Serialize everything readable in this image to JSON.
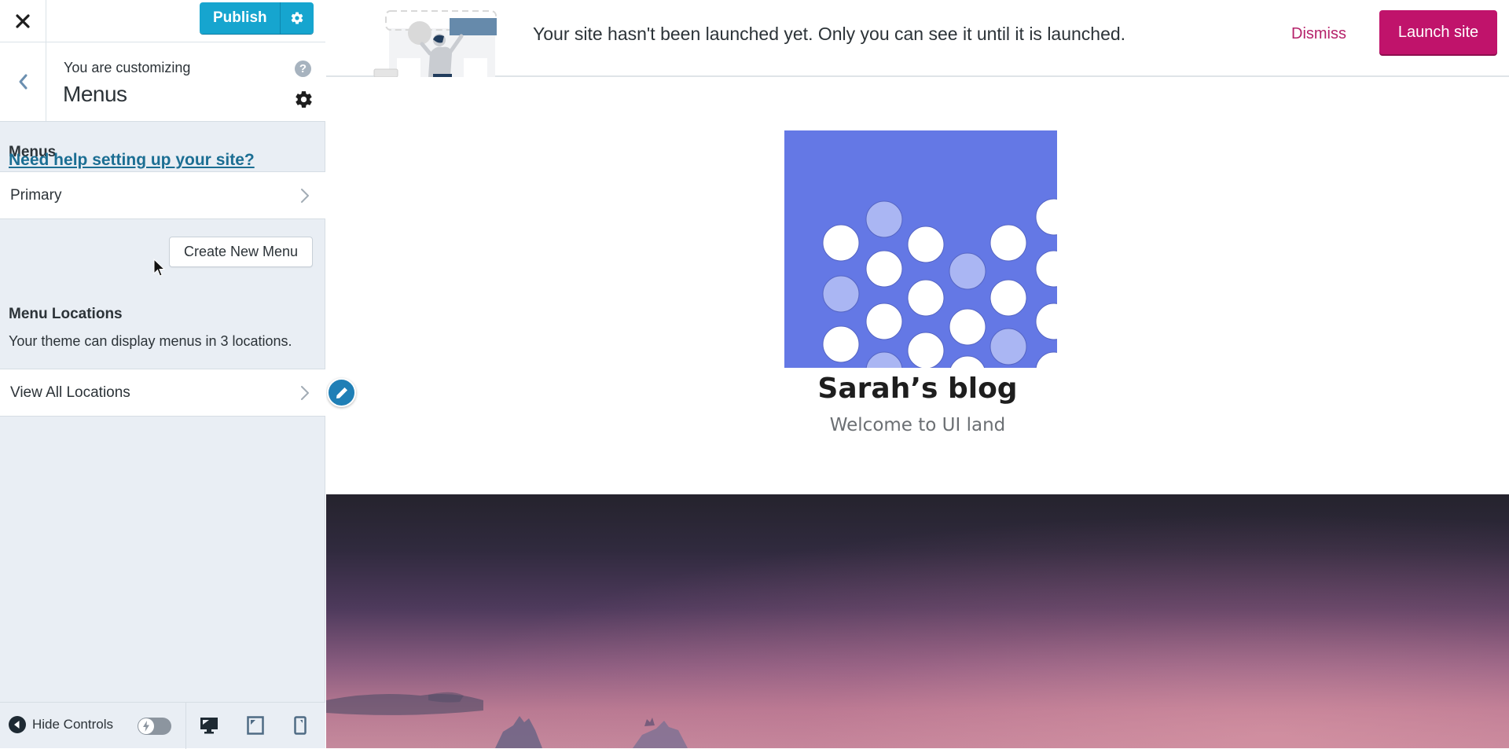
{
  "sidebar": {
    "close_label": "Close",
    "publish_label": "Publish",
    "header": {
      "subtitle": "You are customizing",
      "title": "Menus",
      "help_glyph": "?"
    },
    "menus_section_label": "Menus",
    "help_link": "Need help setting up your site?",
    "menus": [
      {
        "label": "Primary"
      }
    ],
    "create_menu_label": "Create New Menu",
    "locations": {
      "heading": "Menu Locations",
      "description": "Your theme can display menus in 3 locations.",
      "view_all_label": "View All Locations"
    },
    "footer": {
      "hide_controls_label": "Hide Controls",
      "devices": [
        "desktop",
        "tablet",
        "mobile"
      ],
      "active_device": "desktop"
    }
  },
  "preview": {
    "banner": {
      "message": "Your site hasn't been launched yet. Only you can see it until it is launched.",
      "dismiss_label": "Dismiss",
      "launch_label": "Launch site"
    },
    "site": {
      "title": "Sarah’s blog",
      "tagline": "Welcome to UI land"
    }
  },
  "colors": {
    "accent_blue": "#16a5cf",
    "launch_pink": "#c0136b",
    "link_blue": "#1b6e93",
    "logo_blue": "#6478e5",
    "sidebar_bg": "#e9eef4"
  }
}
